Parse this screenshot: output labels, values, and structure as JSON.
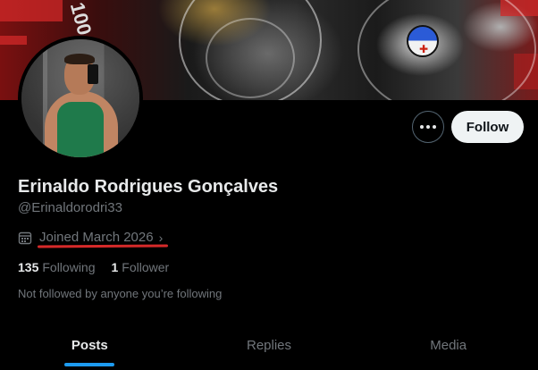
{
  "banner": {
    "decor_text": "100"
  },
  "actions": {
    "more_icon": "more-horizontal-icon",
    "follow_label": "Follow"
  },
  "profile": {
    "display_name": "Erinaldo Rodrigues Gonçalves",
    "handle": "@Erinaldorodri33",
    "joined": "Joined March 2026",
    "joined_icon": "calendar-icon",
    "following_count": "135",
    "following_label": "Following",
    "followers_count": "1",
    "followers_label": "Follower",
    "not_followed_text": "Not followed by anyone you’re following"
  },
  "tabs": [
    {
      "label": "Posts",
      "active": true
    },
    {
      "label": "Replies",
      "active": false
    },
    {
      "label": "Media",
      "active": false
    }
  ],
  "colors": {
    "accent": "#1d9bf0",
    "annotation": "#d62a2a"
  }
}
